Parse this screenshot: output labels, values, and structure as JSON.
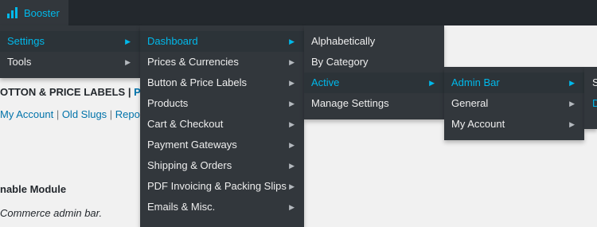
{
  "adminbar": {
    "brand": "Booster"
  },
  "colors": {
    "accent": "#00b9eb",
    "bar": "#23282d",
    "menu": "#32373c",
    "link": "#0073aa"
  },
  "menu1": [
    {
      "label": "Settings",
      "active": true
    },
    {
      "label": "Tools",
      "active": false
    }
  ],
  "menu2": [
    {
      "label": "Dashboard",
      "active": true
    },
    {
      "label": "Prices & Currencies"
    },
    {
      "label": "Button & Price Labels"
    },
    {
      "label": "Products"
    },
    {
      "label": "Cart & Checkout"
    },
    {
      "label": "Payment Gateways"
    },
    {
      "label": "Shipping & Orders"
    },
    {
      "label": "PDF Invoicing & Packing Slips"
    },
    {
      "label": "Emails & Misc."
    }
  ],
  "menu3": [
    {
      "label": "Alphabetically"
    },
    {
      "label": "By Category"
    },
    {
      "label": "Active",
      "active": true
    },
    {
      "label": "Manage Settings"
    }
  ],
  "menu4": [
    {
      "label": "Admin Bar",
      "active": true
    },
    {
      "label": "General"
    },
    {
      "label": "My Account"
    }
  ],
  "menu5_partial": [
    "S",
    "D"
  ],
  "content": {
    "breadcrumb_a": "OTTON & PRICE LABELS",
    "breadcrumb_sep": " | ",
    "breadcrumb_b": "PRO",
    "links": [
      "My Account",
      "Old Slugs",
      "Repo"
    ],
    "heading": "nable Module",
    "description": "Commerce admin bar."
  }
}
